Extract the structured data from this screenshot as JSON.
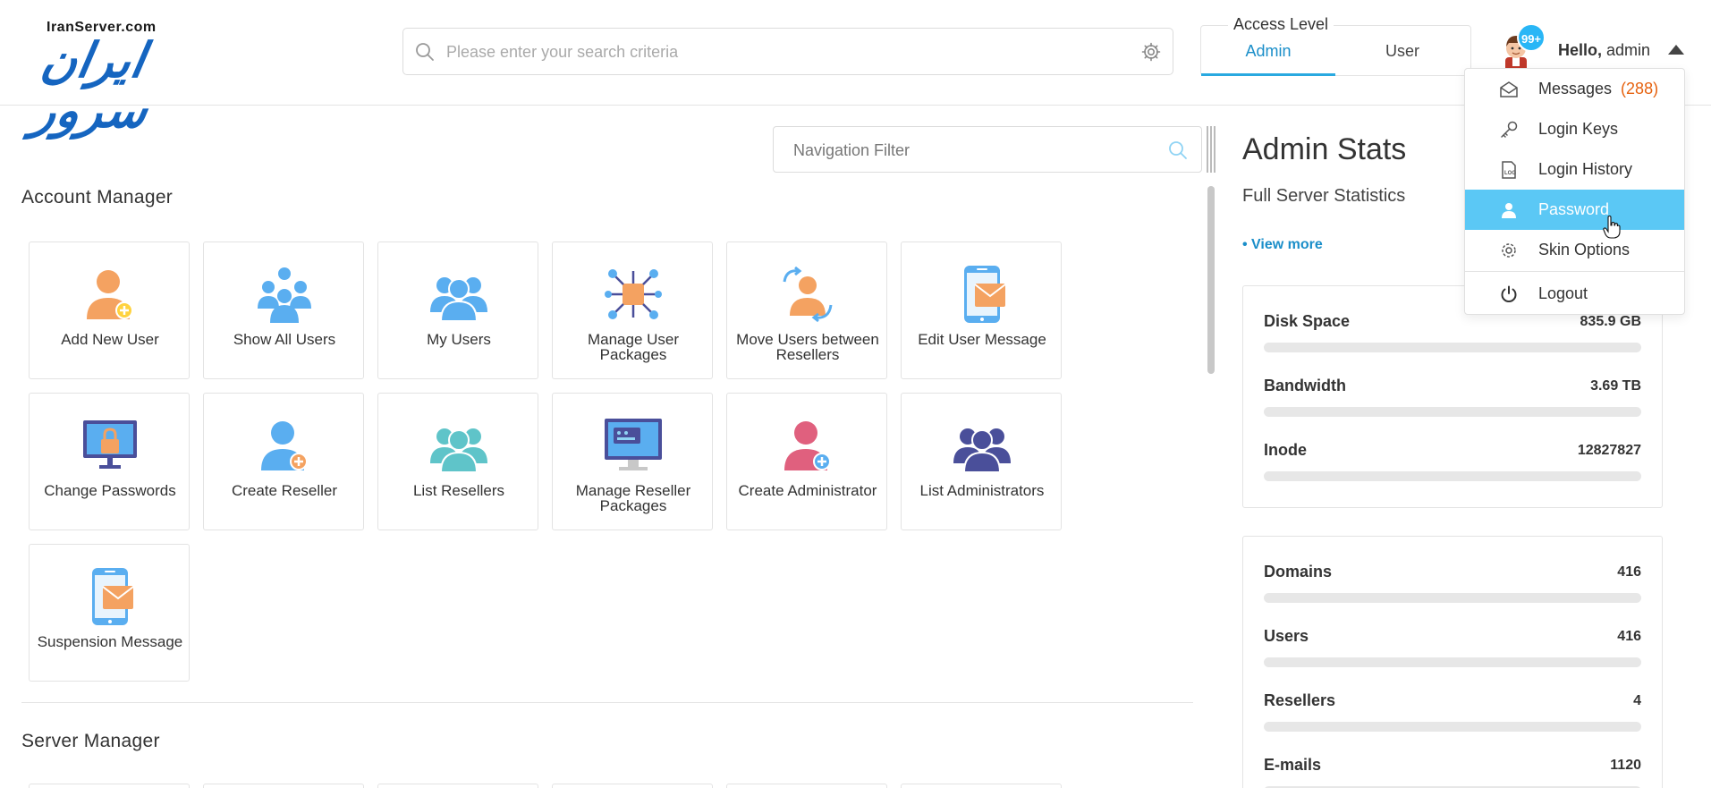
{
  "header": {
    "logo_en": "IranServer.com",
    "logo_fa": "ایران سرور",
    "search_placeholder": "Please enter your search criteria",
    "access_level": {
      "title": "Access Level",
      "tabs": [
        "Admin",
        "User"
      ],
      "active": "Admin"
    },
    "notification_badge": "99+",
    "greeting": "Hello,",
    "username": "admin"
  },
  "user_menu": {
    "items": [
      {
        "label": "Messages",
        "count": "(288)",
        "icon": "envelope-icon"
      },
      {
        "label": "Login Keys",
        "icon": "key-icon"
      },
      {
        "label": "Login History",
        "icon": "log-icon"
      },
      {
        "label": "Password",
        "icon": "user-icon",
        "active": true
      },
      {
        "label": "Skin Options",
        "icon": "gear-icon"
      },
      {
        "label": "Logout",
        "icon": "power-icon"
      }
    ]
  },
  "navigation": {
    "filter_placeholder": "Navigation Filter",
    "sections": [
      {
        "title": "Account Manager",
        "items": [
          {
            "label": "Add New User",
            "icon": "add-user-icon"
          },
          {
            "label": "Show All Users",
            "icon": "users-group-icon"
          },
          {
            "label": "My Users",
            "icon": "my-users-icon"
          },
          {
            "label": "Manage User Packages",
            "icon": "packages-icon"
          },
          {
            "label": "Move Users between Resellers",
            "icon": "move-users-icon"
          },
          {
            "label": "Edit User Message",
            "icon": "phone-message-icon"
          },
          {
            "label": "Change Passwords",
            "icon": "monitor-lock-icon"
          },
          {
            "label": "Create Reseller",
            "icon": "create-reseller-icon"
          },
          {
            "label": "List Resellers",
            "icon": "resellers-group-icon"
          },
          {
            "label": "Manage Reseller Packages",
            "icon": "monitor-package-icon"
          },
          {
            "label": "Create Administrator",
            "icon": "create-admin-icon"
          },
          {
            "label": "List Administrators",
            "icon": "admins-group-icon"
          },
          {
            "label": "Suspension Message",
            "icon": "phone-message-icon"
          }
        ]
      },
      {
        "title": "Server Manager"
      }
    ]
  },
  "admin_stats": {
    "title": "Admin Stats",
    "subtitle": "Full Server Statistics",
    "view_more": "• View more",
    "card1": [
      {
        "name": "Disk Space",
        "value": "835.9 GB",
        "usage": 0
      },
      {
        "name": "Bandwidth",
        "value": "3.69 TB",
        "usage": 0
      },
      {
        "name": "Inode",
        "value": "12827827",
        "usage": 0
      }
    ],
    "card2": [
      {
        "name": "Domains",
        "value": "416",
        "usage": 0
      },
      {
        "name": "Users",
        "value": "416",
        "usage": 0
      },
      {
        "name": "Resellers",
        "value": "4",
        "usage": 0
      },
      {
        "name": "E-mails",
        "value": "1120",
        "usage": 0
      }
    ]
  },
  "colors": {
    "accent": "#29a9e0",
    "orange": "#f4a261",
    "blue": "#5aaef0",
    "teal": "#5fc4c9",
    "red": "#e0607e",
    "navy": "#4a4f9a",
    "message_count": "#e6620f"
  }
}
